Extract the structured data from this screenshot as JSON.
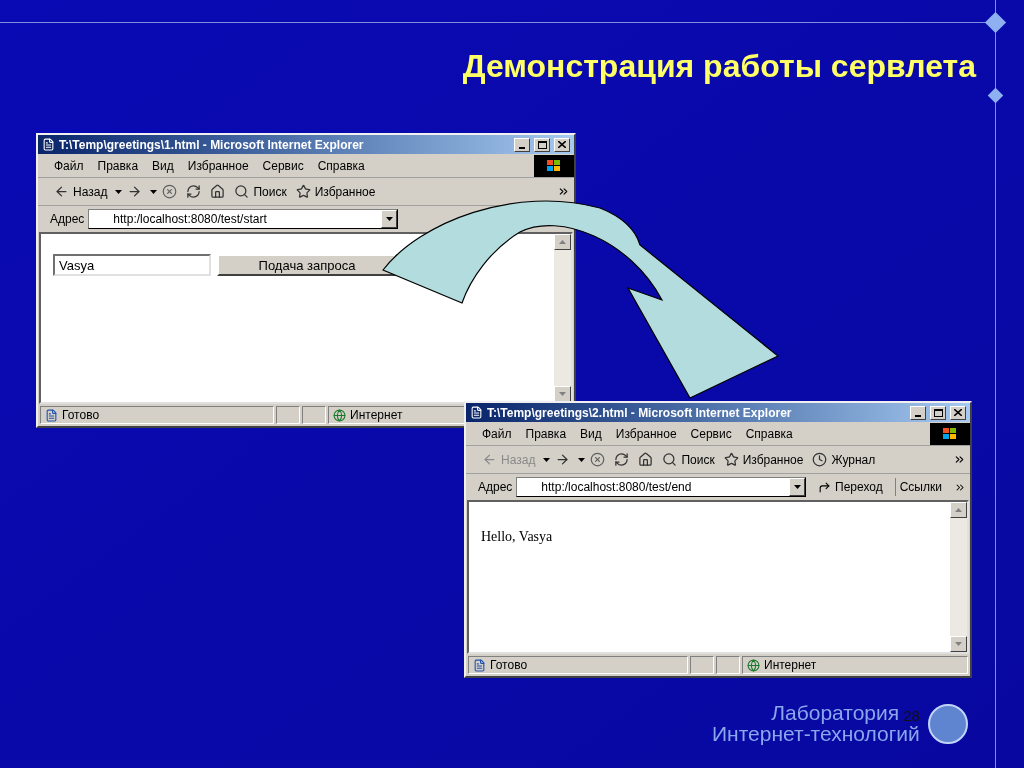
{
  "slide": {
    "title": "Демонстрация работы сервлета",
    "page_number": "28",
    "footer": {
      "line_1": "Лаборатория",
      "line_2": "Интернет-технологий"
    }
  },
  "windows": [
    {
      "title": "T:\\Temp\\greetings\\1.html - Microsoft Internet Explorer",
      "menu": [
        "Файл",
        "Правка",
        "Вид",
        "Избранное",
        "Сервис",
        "Справка"
      ],
      "toolbar": [
        {
          "kind": "back",
          "label": "Назад",
          "disabled": false
        },
        {
          "kind": "forward"
        },
        {
          "kind": "stop"
        },
        {
          "kind": "refresh"
        },
        {
          "kind": "home"
        },
        {
          "kind": "search",
          "label": "Поиск"
        },
        {
          "kind": "favorites",
          "label": "Избранное"
        }
      ],
      "address_label": "Адрес",
      "url": "http:/localhost:8080/test/start",
      "content": {
        "kind": "form",
        "input_value": "Vasya",
        "button": "Подача запроса"
      },
      "status": "Готово",
      "zone": "Интернет"
    },
    {
      "title": "T:\\Temp\\greetings\\2.html - Microsoft Internet Explorer",
      "menu": [
        "Файл",
        "Правка",
        "Вид",
        "Избранное",
        "Сервис",
        "Справка"
      ],
      "toolbar": [
        {
          "kind": "back",
          "label": "Назад",
          "disabled": true
        },
        {
          "kind": "forward"
        },
        {
          "kind": "stop"
        },
        {
          "kind": "refresh"
        },
        {
          "kind": "home"
        },
        {
          "kind": "search",
          "label": "Поиск"
        },
        {
          "kind": "favorites",
          "label": "Избранное"
        },
        {
          "kind": "history",
          "label": "Журнал"
        }
      ],
      "address_label": "Адрес",
      "url": "http:/localhost:8080/test/end",
      "go_label": "Переход",
      "links_label": "Ссылки",
      "content": {
        "kind": "text",
        "text": "Hello, Vasya"
      },
      "status": "Готово",
      "zone": "Интернет"
    }
  ]
}
